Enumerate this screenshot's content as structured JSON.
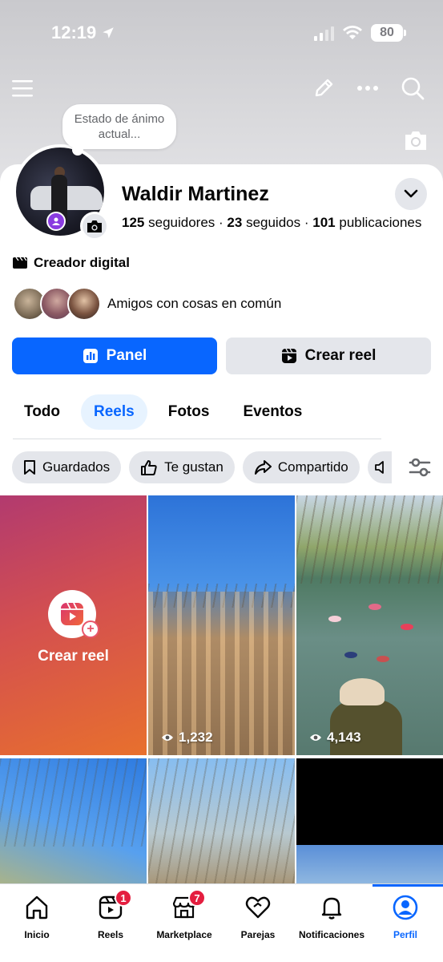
{
  "status_bar": {
    "time": "12:19",
    "battery": "80"
  },
  "profile": {
    "mood_placeholder": "Estado de ánimo actual...",
    "name": "Waldir Martinez",
    "followers_count": "125",
    "followers_label": "seguidores",
    "following_count": "23",
    "following_label": "seguidos",
    "posts_count": "101",
    "posts_label": "publicaciones",
    "category": "Creador digital",
    "mutual_friends_label": "Amigos con cosas en común"
  },
  "actions": {
    "panel_label": "Panel",
    "create_reel_label": "Crear reel"
  },
  "tabs": [
    {
      "label": "Todo",
      "active": false
    },
    {
      "label": "Reels",
      "active": true
    },
    {
      "label": "Fotos",
      "active": false
    },
    {
      "label": "Eventos",
      "active": false
    }
  ],
  "filters": [
    {
      "label": "Guardados",
      "icon": "bookmark-icon"
    },
    {
      "label": "Te gustan",
      "icon": "thumbs-up-icon"
    },
    {
      "label": "Compartido",
      "icon": "share-icon"
    }
  ],
  "reels": {
    "create_label": "Crear reel",
    "items": [
      {
        "views": "1,232"
      },
      {
        "views": "4,143"
      }
    ]
  },
  "bottom_nav": [
    {
      "label": "Inicio",
      "icon": "home-icon",
      "badge": ""
    },
    {
      "label": "Reels",
      "icon": "reels-icon",
      "badge": "1"
    },
    {
      "label": "Marketplace",
      "icon": "marketplace-icon",
      "badge": "7"
    },
    {
      "label": "Parejas",
      "icon": "heart-icon",
      "badge": ""
    },
    {
      "label": "Notificaciones",
      "icon": "bell-icon",
      "badge": ""
    },
    {
      "label": "Perfil",
      "icon": "profile-icon",
      "badge": "",
      "active": true
    }
  ],
  "colors": {
    "accent": "#0866ff",
    "badge": "#e41e3f",
    "chip_bg": "#e4e6eb"
  }
}
